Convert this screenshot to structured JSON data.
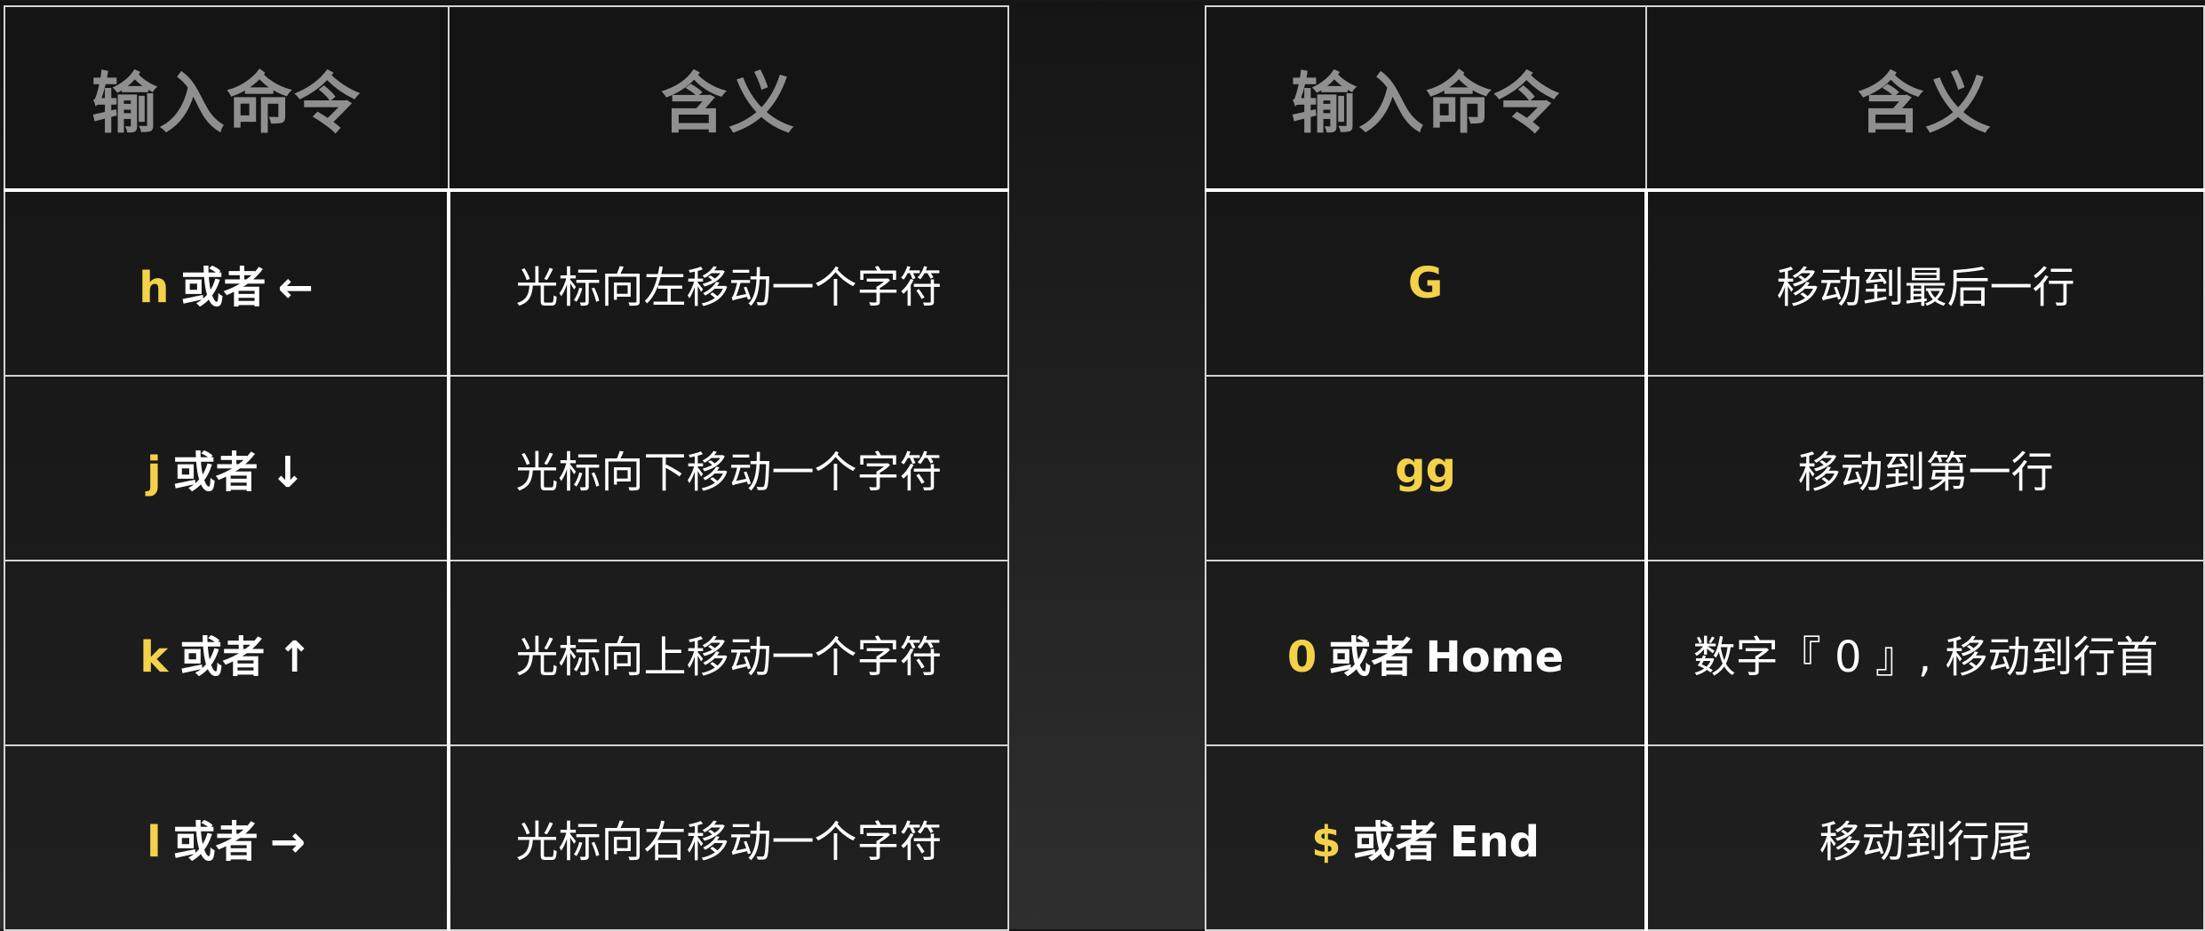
{
  "tables": [
    {
      "header": {
        "command": "输入命令",
        "meaning": "含义"
      },
      "rows": [
        {
          "key": "h",
          "connector": "或者",
          "alt": "←",
          "meaning": "光标向左移动一个字符"
        },
        {
          "key": "j",
          "connector": "或者",
          "alt": "↓",
          "meaning": "光标向下移动一个字符"
        },
        {
          "key": "k",
          "connector": "或者",
          "alt": "↑",
          "meaning": "光标向上移动一个字符"
        },
        {
          "key": "l",
          "connector": "或者",
          "alt": "→",
          "meaning": "光标向右移动一个字符"
        }
      ]
    },
    {
      "header": {
        "command": "输入命令",
        "meaning": "含义"
      },
      "rows": [
        {
          "key": "G",
          "meaning": "移动到最后一行"
        },
        {
          "key": "gg",
          "meaning": "移动到第一行"
        },
        {
          "key": "0",
          "connector": "或者",
          "alt": "Home",
          "meaning": "数字『 0 』, 移动到行首"
        },
        {
          "key": "$",
          "connector": "或者",
          "alt": "End",
          "meaning": "移动到行尾"
        }
      ]
    }
  ],
  "colors": {
    "key_highlight": "#f3d24a",
    "header_text": "#8f8f8f",
    "body_text": "#ffffff",
    "border": "#d4d4d4"
  }
}
